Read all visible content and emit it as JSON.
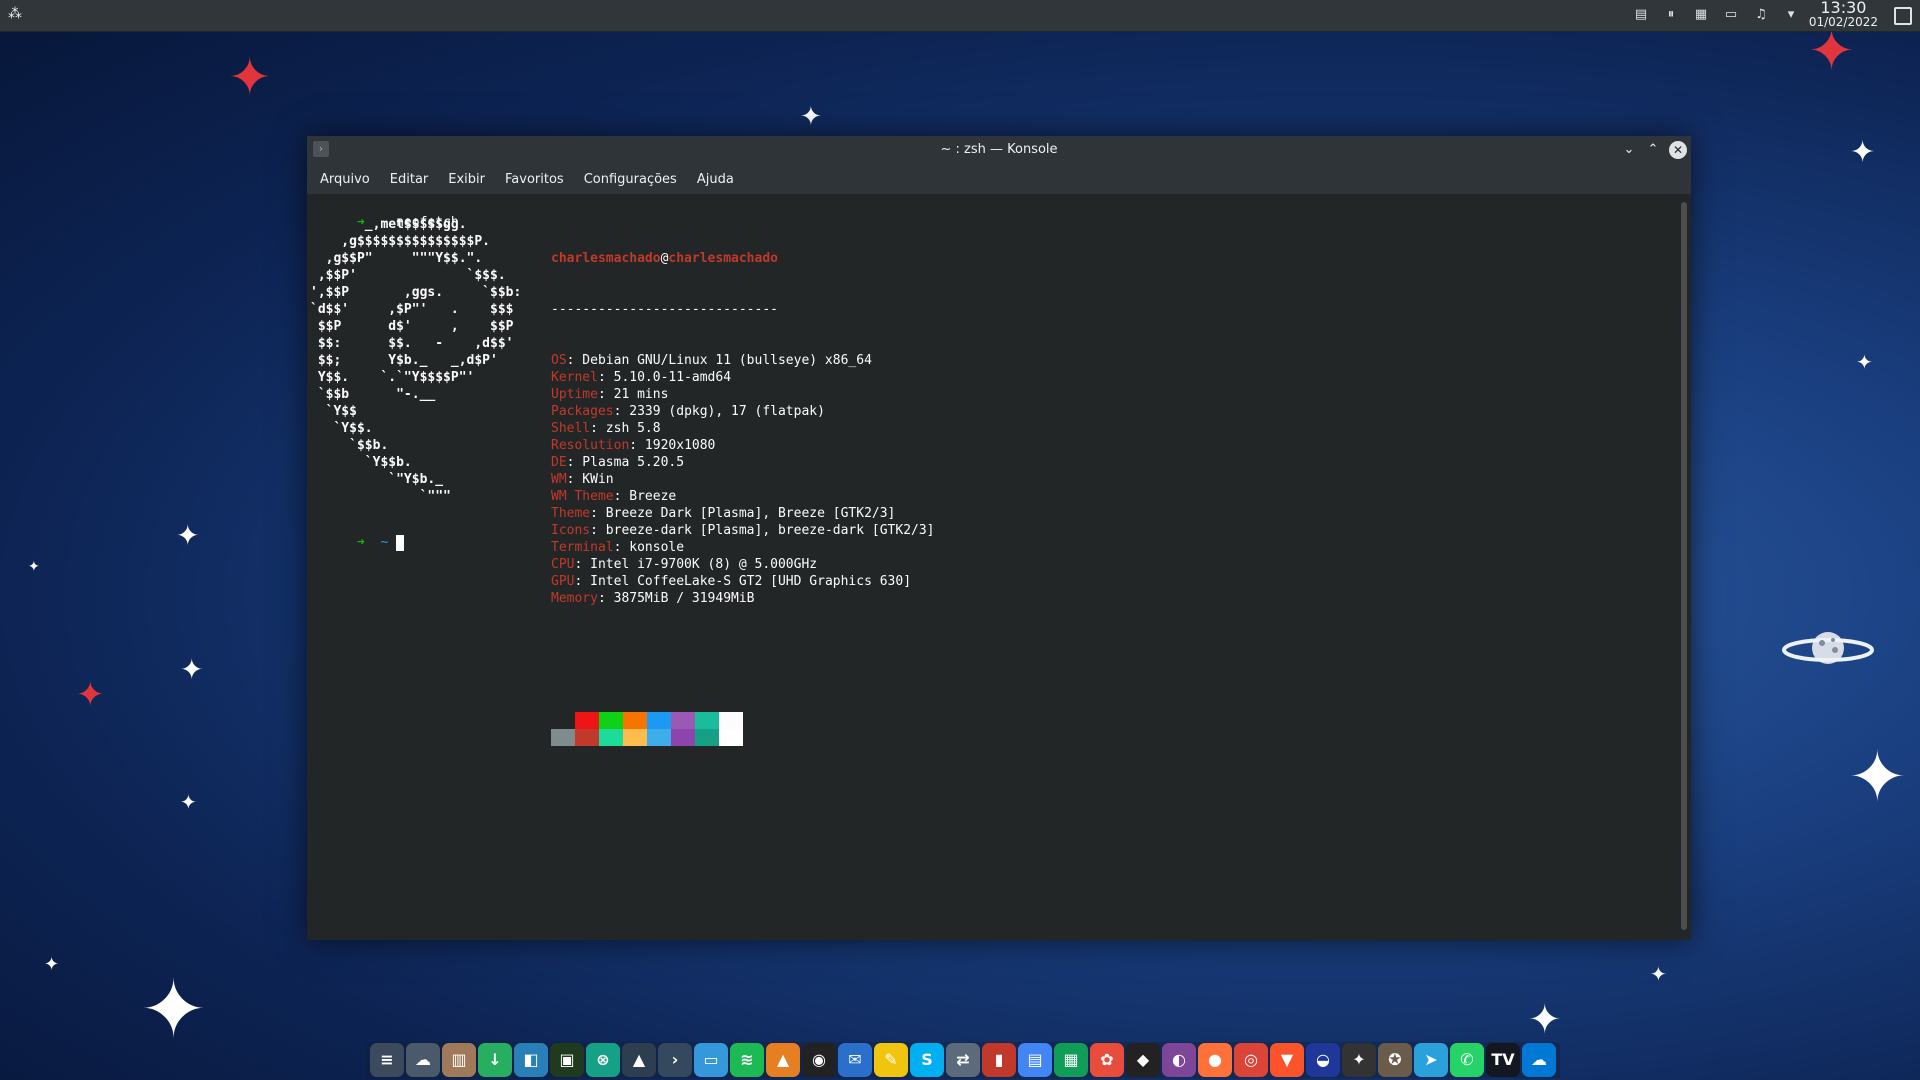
{
  "panel": {
    "clock_time": "13:30",
    "clock_date": "01/02/2022"
  },
  "window": {
    "title": "~ : zsh — Konsole",
    "menu": [
      "Arquivo",
      "Editar",
      "Exibir",
      "Favoritos",
      "Configurações",
      "Ajuda"
    ]
  },
  "terminal": {
    "prompt_arrow": "➜",
    "prompt_dir": "~",
    "command": "neofetch",
    "user": "charlesmachado",
    "at": "@",
    "host": "charlesmachado",
    "separator": "-----------------------------",
    "info": [
      {
        "key": "OS",
        "value": "Debian GNU/Linux 11 (bullseye) x86_64"
      },
      {
        "key": "Kernel",
        "value": "5.10.0-11-amd64"
      },
      {
        "key": "Uptime",
        "value": "21 mins"
      },
      {
        "key": "Packages",
        "value": "2339 (dpkg), 17 (flatpak)"
      },
      {
        "key": "Shell",
        "value": "zsh 5.8"
      },
      {
        "key": "Resolution",
        "value": "1920x1080"
      },
      {
        "key": "DE",
        "value": "Plasma 5.20.5"
      },
      {
        "key": "WM",
        "value": "KWin"
      },
      {
        "key": "WM Theme",
        "value": "Breeze"
      },
      {
        "key": "Theme",
        "value": "Breeze Dark [Plasma], Breeze [GTK2/3]"
      },
      {
        "key": "Icons",
        "value": "breeze-dark [Plasma], breeze-dark [GTK2/3]"
      },
      {
        "key": "Terminal",
        "value": "konsole"
      },
      {
        "key": "CPU",
        "value": "Intel i7-9700K (8) @ 5.000GHz"
      },
      {
        "key": "GPU",
        "value": "Intel CoffeeLake-S GT2 [UHD Graphics 630]"
      },
      {
        "key": "Memory",
        "value": "3875MiB / 31949MiB"
      }
    ],
    "logo": [
      "       _,met$$$$$gg.",
      "    ,g$$$$$$$$$$$$$$$P.",
      "  ,g$$P\"     \"\"\"Y$$.\".",
      " ,$$P'              `$$$.",
      "',$$P       ,ggs.     `$$b:",
      "`d$$'     ,$P\"'   .    $$$",
      " $$P      d$'     ,    $$P",
      " $$:      $$.   -    ,d$$'",
      " $$;      Y$b._   _,d$P'",
      " Y$$.    `.`\"Y$$$$P\"'",
      " `$$b      \"-.__",
      "  `Y$$",
      "   `Y$$.",
      "     `$$b.",
      "       `Y$$b.",
      "          `\"Y$b._",
      "              `\"\"\""
    ],
    "palette_top": [
      "#232627",
      "#ed1515",
      "#11d116",
      "#f67400",
      "#1d99f3",
      "#9b59b6",
      "#1abc9c",
      "#fcfcfc"
    ],
    "palette_bottom": [
      "#7f8c8d",
      "#c0392b",
      "#1cdc9a",
      "#fdbc4b",
      "#3daee9",
      "#8e44ad",
      "#16a085",
      "#ffffff"
    ]
  },
  "dock_icons": [
    {
      "name": "filelight-icon",
      "color": "#3b4a5c",
      "glyph": "≡"
    },
    {
      "name": "nextcloud-icon",
      "color": "#4a5a6a",
      "glyph": "☁"
    },
    {
      "name": "archive-icon",
      "color": "#a0785a",
      "glyph": "▥"
    },
    {
      "name": "download-manager-icon",
      "color": "#27ae60",
      "glyph": "↓"
    },
    {
      "name": "discover-icon",
      "color": "#2980b9",
      "glyph": "◧"
    },
    {
      "name": "terminal-app-icon",
      "color": "#1f3a1f",
      "glyph": "▣"
    },
    {
      "name": "xdm-icon",
      "color": "#16a085",
      "glyph": "⊗"
    },
    {
      "name": "system-monitor-icon",
      "color": "#2c3e50",
      "glyph": "▲"
    },
    {
      "name": "konsole-icon",
      "color": "#34495e",
      "glyph": "›"
    },
    {
      "name": "dolphin-icon",
      "color": "#3498db",
      "glyph": "▭"
    },
    {
      "name": "spotify-icon",
      "color": "#1db954",
      "glyph": "≋"
    },
    {
      "name": "vlc-icon",
      "color": "#e67e22",
      "glyph": "▲"
    },
    {
      "name": "obs-icon",
      "color": "#222222",
      "glyph": "◉"
    },
    {
      "name": "thunderbird-icon",
      "color": "#2a6fc9",
      "glyph": "✉"
    },
    {
      "name": "notes-icon",
      "color": "#f1c40f",
      "glyph": "✎"
    },
    {
      "name": "skype-icon",
      "color": "#00aff0",
      "glyph": "S"
    },
    {
      "name": "anydesk-icon",
      "color": "#5b6b7b",
      "glyph": "⇄"
    },
    {
      "name": "paint-icon",
      "color": "#c0392b",
      "glyph": "▮"
    },
    {
      "name": "docs-icon",
      "color": "#4285f4",
      "glyph": "▤"
    },
    {
      "name": "sheets-icon",
      "color": "#0f9d58",
      "glyph": "▦"
    },
    {
      "name": "chat-icon",
      "color": "#e74c3c",
      "glyph": "✿"
    },
    {
      "name": "binance-icon",
      "color": "#222222",
      "glyph": "◆"
    },
    {
      "name": "tor-icon",
      "color": "#7d4698",
      "glyph": "◐"
    },
    {
      "name": "firefox-icon",
      "color": "#ff7139",
      "glyph": "●"
    },
    {
      "name": "chrome-icon",
      "color": "#db4437",
      "glyph": "◎"
    },
    {
      "name": "brave-icon",
      "color": "#fb542b",
      "glyph": "▼"
    },
    {
      "name": "vpn-icon",
      "color": "#1e3799",
      "glyph": "◒"
    },
    {
      "name": "inkscape-icon",
      "color": "#333333",
      "glyph": "✦"
    },
    {
      "name": "gimp-icon",
      "color": "#6b5b4b",
      "glyph": "✪"
    },
    {
      "name": "telegram-icon",
      "color": "#2aa1da",
      "glyph": "➤"
    },
    {
      "name": "whatsapp-icon",
      "color": "#25d366",
      "glyph": "✆"
    },
    {
      "name": "tradingview-icon",
      "color": "#131722",
      "glyph": "TV"
    },
    {
      "name": "onedrive-icon",
      "color": "#0078d4",
      "glyph": "☁"
    }
  ]
}
